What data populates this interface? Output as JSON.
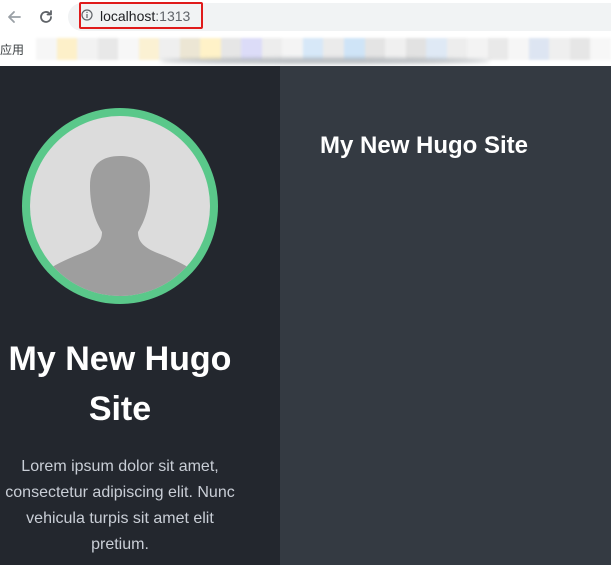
{
  "browser": {
    "url_host": "localhost",
    "url_port": ":1313",
    "bookmarks": {
      "apps_label": "应用",
      "blurred_colors": [
        "#f6f6f6",
        "#fdf0c9",
        "#f2f2f2",
        "#e8e8e8",
        "#f7f7f7",
        "#fbf1d3",
        "#efefef",
        "#ece6d4",
        "#fff2c8",
        "#e6e6e6",
        "#dcdcf8",
        "#ededed",
        "#f4f4f4",
        "#d7e8f8",
        "#ebebeb",
        "#cfe4f7",
        "#e4e4e4",
        "#f0f0f0",
        "#e2e2e2",
        "#dfe9f5",
        "#ededed",
        "#f3f3f3",
        "#e9e9e9",
        "#f6f6f6",
        "#dde5f2",
        "#efefef",
        "#e6e6e6",
        "#f7f7f7"
      ]
    }
  },
  "colors": {
    "sidebar_bg": "#23272e",
    "main_bg": "#343a42",
    "avatar_ring": "#5ac88a",
    "highlight": "#e01b1b"
  },
  "sidebar": {
    "title": "My New Hugo Site",
    "description": "Lorem ipsum dolor sit amet, consectetur adipiscing elit. Nunc vehicula turpis sit amet elit pretium."
  },
  "main": {
    "title": "My New Hugo Site"
  },
  "icons": {
    "back": "arrow-left",
    "reload": "reload",
    "site_info": "info-circle",
    "avatar": "default-user-silhouette"
  }
}
